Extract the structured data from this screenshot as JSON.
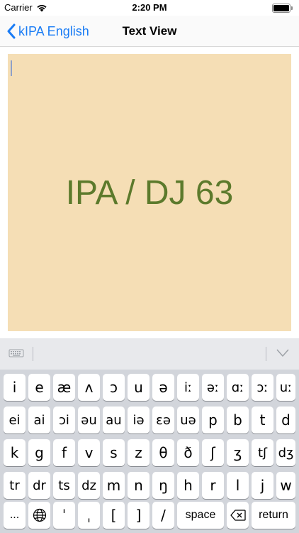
{
  "status_bar": {
    "carrier": "Carrier",
    "time": "2:20 PM"
  },
  "nav": {
    "back_label": "kIPA English",
    "title": "Text View"
  },
  "text_view": {
    "content": "IPA / DJ 63"
  },
  "keyboard": {
    "rows": [
      [
        "i",
        "e",
        "æ",
        "ʌ",
        "ɔ",
        "u",
        "ə",
        "iː",
        "əː",
        "ɑː",
        "ɔː",
        "uː"
      ],
      [
        "ei",
        "ai",
        "ɔi",
        "əu",
        "au",
        "iə",
        "ɛə",
        "uə",
        "p",
        "b",
        "t",
        "d"
      ],
      [
        "k",
        "g",
        "f",
        "v",
        "s",
        "z",
        "θ",
        "ð",
        "ʃ",
        "ʒ",
        "tʃ",
        "dʒ"
      ],
      [
        "tr",
        "dr",
        "ts",
        "dz",
        "m",
        "n",
        "ŋ",
        "h",
        "r",
        "l",
        "j",
        "w"
      ]
    ],
    "bottom": {
      "more": "...",
      "stress_primary": "ˈ",
      "stress_secondary": "ˌ",
      "bracket_open": "[",
      "bracket_close": "]",
      "slash": "/",
      "space": "space",
      "return": "return"
    }
  }
}
